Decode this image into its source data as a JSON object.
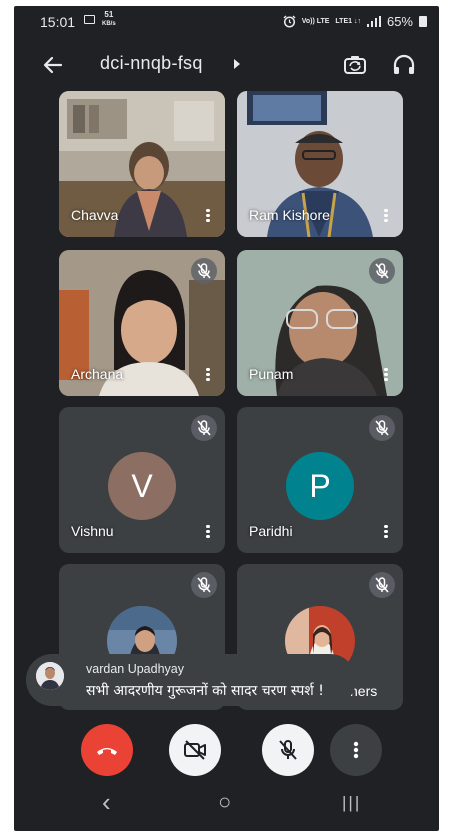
{
  "status_bar": {
    "time": "15:01",
    "net_speed_value": "51",
    "net_speed_unit": "KB/s",
    "volte": "Vo)) LTE",
    "lte": "LTE1 ↓↑",
    "battery": "65%"
  },
  "header": {
    "meeting_code": "dci-nnqb-fsq",
    "back_icon": "arrow-left-icon",
    "switch_camera_icon": "camera-switch-icon",
    "audio_icon": "headphones-icon"
  },
  "participants": [
    {
      "name": "Chavva",
      "muted": false,
      "type": "video"
    },
    {
      "name": "Ram Kishore",
      "muted": false,
      "type": "video"
    },
    {
      "name": "Archana",
      "muted": true,
      "type": "video"
    },
    {
      "name": "Punam",
      "muted": true,
      "type": "video"
    },
    {
      "name": "Vishnu",
      "muted": true,
      "type": "initial",
      "initial": "V",
      "color": "#8d6e63"
    },
    {
      "name": "Paridhi",
      "muted": true,
      "type": "initial",
      "initial": "P",
      "color": "#00838f"
    },
    {
      "name": "",
      "muted": true,
      "type": "photo"
    },
    {
      "name": "",
      "muted": true,
      "type": "photo"
    }
  ],
  "chat_toast": {
    "sender": "vardan Upadhyay",
    "message": "सभी आदरणीय गुरूजनों को सादर चरण स्पर्श !"
  },
  "others_pill": {
    "label": "ners"
  },
  "controls": {
    "end_call_color": "#ea4335",
    "end_call_icon": "phone-hangup-icon",
    "camera_icon": "video-off-icon",
    "mic_icon": "mic-off-icon",
    "more_icon": "more-vert-icon"
  },
  "nav_bar": {
    "back": "‹",
    "home": "○",
    "recents": "|||"
  }
}
